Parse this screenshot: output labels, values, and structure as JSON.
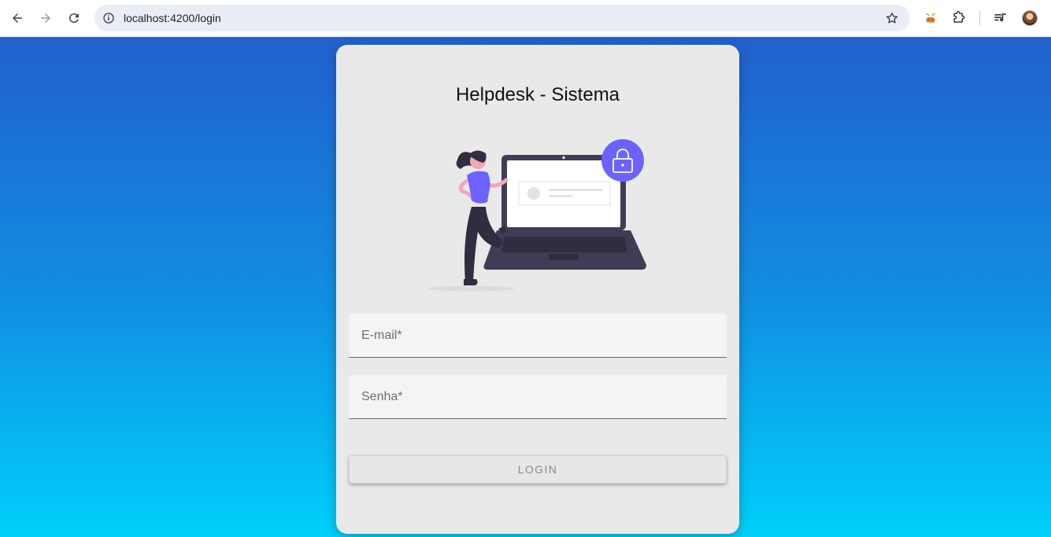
{
  "browser": {
    "url": "localhost:4200/login",
    "icons": [
      "back-icon",
      "forward-icon",
      "reload-icon",
      "site-info-icon",
      "bookmark-star-icon",
      "metamask-extension-icon",
      "extensions-puzzle-icon",
      "media-control-icon",
      "profile-avatar"
    ]
  },
  "login": {
    "title": "Helpdesk - Sistema",
    "email_placeholder": "E-mail*",
    "password_placeholder": "Senha*",
    "button_label": "LOGIN"
  },
  "colors": {
    "gradient_top": "#2260ce",
    "gradient_bottom": "#00d0fb",
    "card_bg": "#e9e9e9",
    "accent_purple": "#6c63ff",
    "laptop_dark": "#3f3d56"
  }
}
